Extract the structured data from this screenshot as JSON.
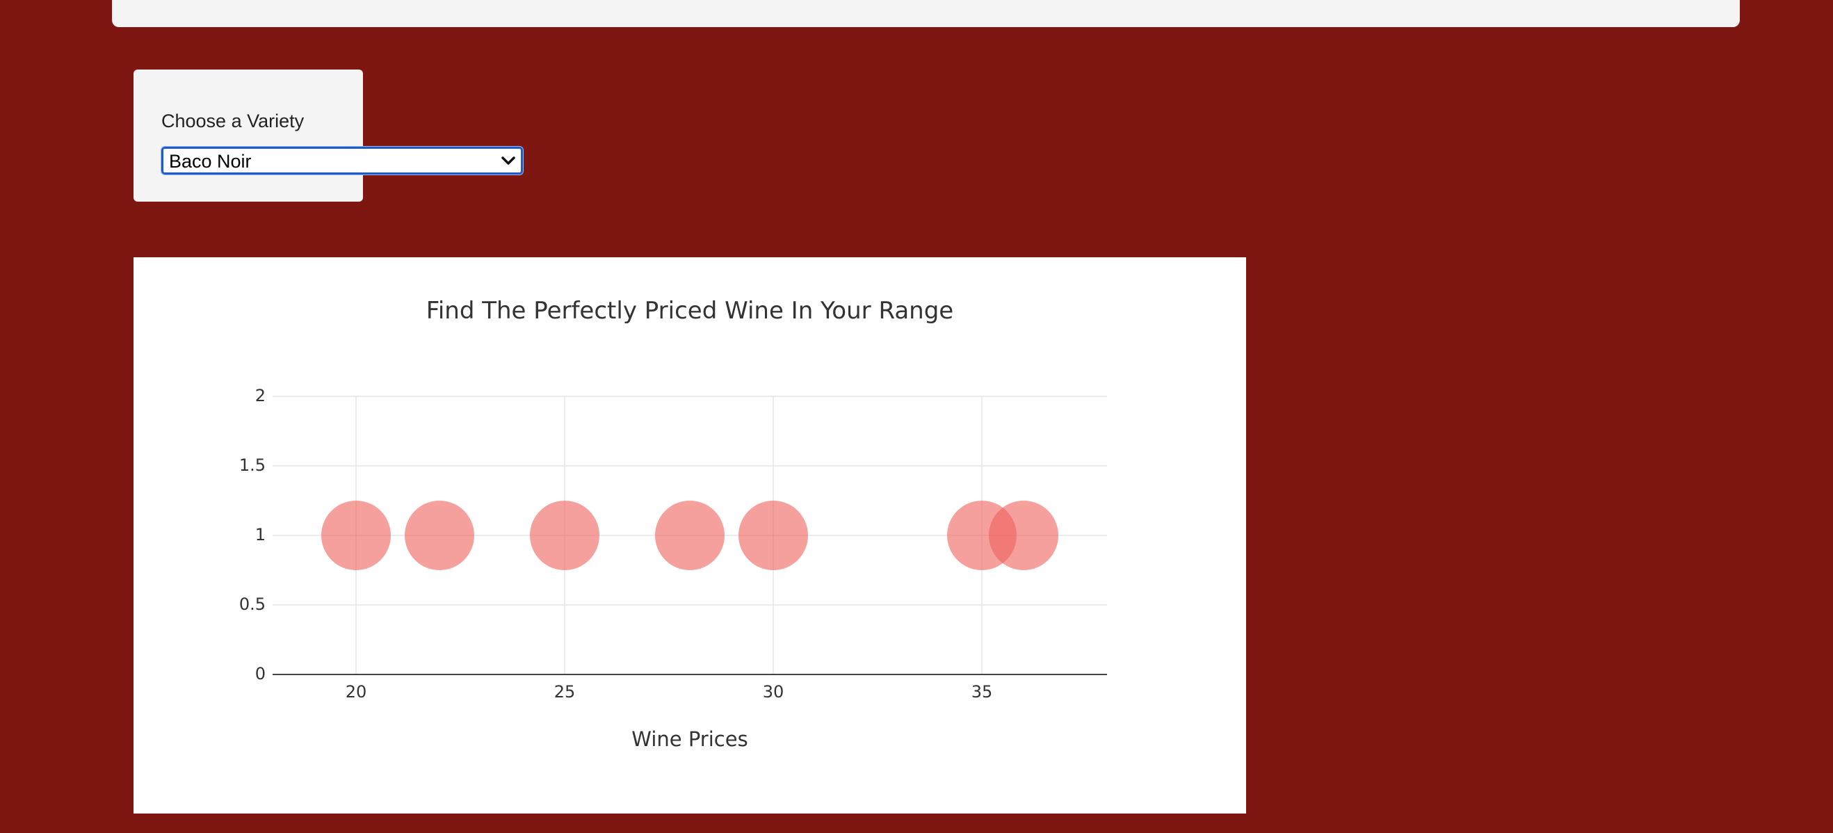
{
  "variety_filter": {
    "label": "Choose a Variety",
    "selected": "Baco Noir"
  },
  "chart_data": {
    "type": "scatter",
    "title": "Find The Perfectly Priced Wine In Your Range",
    "xlabel": "Wine Prices",
    "ylabel": "",
    "xlim": [
      18,
      38
    ],
    "ylim": [
      0,
      2
    ],
    "x_ticks": [
      20,
      25,
      30,
      35
    ],
    "y_ticks": [
      0,
      0.5,
      1,
      1.5,
      2
    ],
    "x_tick_labels": [
      "20",
      "25",
      "30",
      "35"
    ],
    "y_tick_labels": [
      "0",
      "0.5",
      "1",
      "1.5",
      "2"
    ],
    "grid": true,
    "marker_color": "#f0615c",
    "marker_opacity": 0.6,
    "x": [
      20,
      22,
      25,
      28,
      30,
      35,
      36
    ],
    "y": [
      1,
      1,
      1,
      1,
      1,
      1,
      1
    ]
  }
}
